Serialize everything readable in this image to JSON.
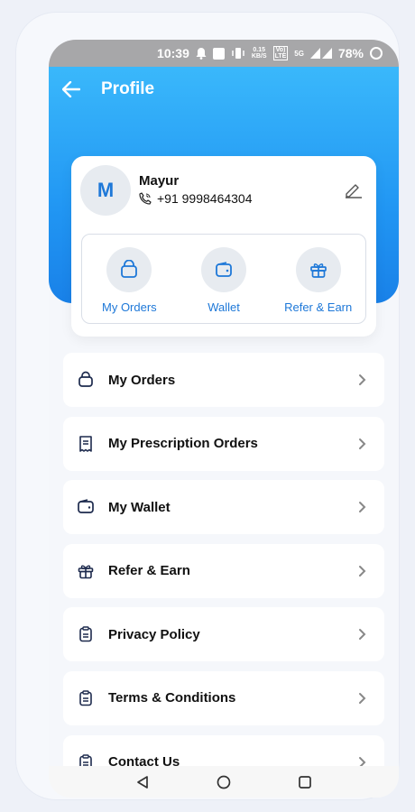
{
  "status": {
    "time": "10:39",
    "net_speed_top": "0.15",
    "net_speed_bottom": "KB/S",
    "volte_top": "Vo)",
    "volte_bottom": "LTE",
    "signal": "5G",
    "battery": "78%"
  },
  "header": {
    "title": "Profile"
  },
  "user": {
    "initial": "M",
    "name": "Mayur",
    "phone": "+91 9998464304"
  },
  "quick_actions": [
    {
      "label": "My Orders",
      "icon": "bag-icon"
    },
    {
      "label": "Wallet",
      "icon": "wallet-icon"
    },
    {
      "label": "Refer & Earn",
      "icon": "gift-icon"
    }
  ],
  "menu": [
    {
      "label": "My Orders",
      "icon": "bag-icon"
    },
    {
      "label": "My Prescription Orders",
      "icon": "receipt-icon"
    },
    {
      "label": "My Wallet",
      "icon": "wallet-icon"
    },
    {
      "label": "Refer & Earn",
      "icon": "gift-icon"
    },
    {
      "label": "Privacy Policy",
      "icon": "clipboard-icon"
    },
    {
      "label": "Terms & Conditions",
      "icon": "clipboard-icon"
    },
    {
      "label": "Contact Us",
      "icon": "clipboard-icon"
    }
  ],
  "colors": {
    "accent": "#1e78d8",
    "hero_top": "#3ab8fb",
    "hero_bottom": "#1981e8",
    "icon_dark": "#1d2a4d"
  }
}
